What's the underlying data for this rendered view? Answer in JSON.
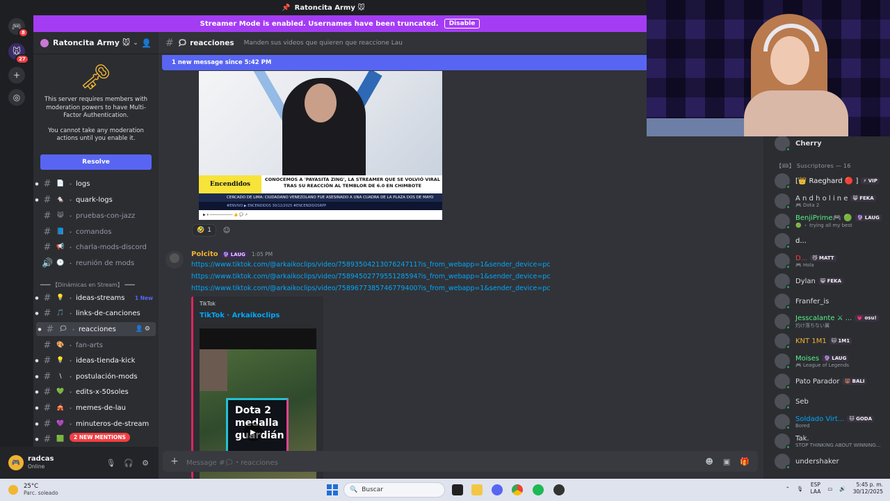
{
  "window": {
    "title": "Ratoncita Army 🐭"
  },
  "rail": {
    "dm_badge": "8",
    "server_badge": "27"
  },
  "streamer_banner": {
    "text": "Streamer Mode is enabled. Usernames have been truncated.",
    "button": "Disable"
  },
  "server": {
    "name": "Ratoncita Army 🐭",
    "mfa_text_1": "This server requires members with moderation powers to have Multi-Factor Authentication.",
    "mfa_text_2": "You cannot take any moderation actions until you enable it.",
    "resolve_label": "Resolve"
  },
  "channels": [
    {
      "name": "logs",
      "emoji": "📄",
      "unread": true
    },
    {
      "name": "quark-logs",
      "emoji": "🐁",
      "unread": true
    },
    {
      "name": "pruebas-con-jazz",
      "emoji": "😸",
      "unread": false
    },
    {
      "name": "comandos",
      "emoji": "📘",
      "unread": false
    },
    {
      "name": "charla-mods-discord",
      "emoji": "📢",
      "unread": false
    },
    {
      "name": "reunión de mods",
      "emoji": "🕒",
      "unread": false,
      "voice": true
    }
  ],
  "category": {
    "label": "━━━ 【Dinámicas en Stream】 ━━━"
  },
  "channels2": [
    {
      "name": "ideas-streams",
      "emoji": "💡",
      "unread": true,
      "badge": "1 New"
    },
    {
      "name": "links-de-canciones",
      "emoji": "🎵",
      "unread": true
    },
    {
      "name": "reacciones",
      "emoji": "🗯",
      "unread": true,
      "active": true
    },
    {
      "name": "fan-arts",
      "emoji": "🎨",
      "unread": false
    },
    {
      "name": "ideas-tienda-kick",
      "emoji": "💡",
      "unread": true
    },
    {
      "name": "postulación-mods",
      "emoji": "\\",
      "unread": true
    },
    {
      "name": "edits-x-50soles",
      "emoji": "💚",
      "unread": true
    },
    {
      "name": "memes-de-lau",
      "emoji": "🎪",
      "unread": true
    },
    {
      "name": "minuteros-de-stream",
      "emoji": "💜",
      "unread": true
    },
    {
      "name": "r",
      "emoji": "🟩",
      "unread": true
    }
  ],
  "mentions_pill": "2 NEW MENTIONS",
  "user": {
    "name": "radcas",
    "status": "Online"
  },
  "chat": {
    "channel": "reacciones",
    "topic": "Manden sus videos que quieren que reaccione Lau",
    "new_messages": "1 new message since 5:42 PM",
    "video": {
      "tag": "Encendidos",
      "headline": "CONOCEMOS A 'PAYASITA ZING', LA STREAMER QUE SE VOLVIÓ VIRAL TRAS SU REACCIÓN AL TEMBLOR DE 6.0 EN CHIMBOTE",
      "ticker": "CERCADO DE LIMA: CIUDADANO VENEZOLANO FUE ASESINADO A UNA CUADRA DE LA PLAZA DOS DE MAYO",
      "ticker2": "#ENVIVO ▶ ENCENDIDOS 30/12/2025 #ENCENDIDOSRPP"
    },
    "reaction": {
      "emoji": "🤣",
      "count": "1"
    },
    "message": {
      "author": "Polcito",
      "role_tag": "🔮 LAUG",
      "time": "1:05 PM",
      "links": [
        "https://www.tiktok.com/@arkaikoclips/video/7589350421307624711?is_from_webapp=1&sender_device=pc",
        "https://www.tiktok.com/@arkaikoclips/video/7589450277955128594?is_from_webapp=1&sender_device=pc",
        "https://www.tiktok.com/@arkaikoclips/video/7589677385746779400?is_from_webapp=1&sender_device=pc"
      ],
      "embed": {
        "provider": "TikTok",
        "title": "TikTok · Arkaikoclips",
        "thumb_text": "Dota 2 medalla guardián"
      }
    },
    "input_placeholder": "Message #🗯・reacciones"
  },
  "members": {
    "top": {
      "name": "Cherry",
      "color": "#f0b232"
    },
    "group_label": "【🎟】 Suscriptores — 16",
    "list": [
      {
        "name": "[👑 Raeghard 🔴 ]",
        "tag": "⚡ VIP",
        "color": "#f2f3f5",
        "sub": ""
      },
      {
        "name": "A n d h o l i n e",
        "tag": "😸 FEKA",
        "color": "#dbdee1",
        "sub": "🎮 Dota 2"
      },
      {
        "name": "BenjiPrime🎮 🟢",
        "tag": "🔮 LAUG",
        "color": "#57f287",
        "sub": "🟢 ・ trying all my best"
      },
      {
        "name": "d...",
        "tag": "",
        "color": "#f2f3f5",
        "sub": ""
      },
      {
        "name": "D...",
        "tag": "😼 MATT",
        "color": "#f23f43",
        "sub": "🎮 Hola"
      },
      {
        "name": "Dylan",
        "tag": "😸 FEKA",
        "color": "#dbdee1",
        "sub": ""
      },
      {
        "name": "Franfer_is",
        "tag": "",
        "color": "#dbdee1",
        "sub": ""
      },
      {
        "name": "Jesscalante ⚔ ...",
        "tag": "💗 osu!",
        "color": "#57f287",
        "sub": "灼け落ちない翼"
      },
      {
        "name": "KNT 1M1",
        "tag": "🐱 1M1",
        "color": "#f0b232",
        "sub": ""
      },
      {
        "name": "Moises",
        "tag": "🔮 LAUG",
        "color": "#57f287",
        "sub": "🎮 League of Legends"
      },
      {
        "name": "Pato Parador",
        "tag": "🐻 BALI",
        "color": "#dbdee1",
        "sub": ""
      },
      {
        "name": "Seb",
        "tag": "",
        "color": "#dbdee1",
        "sub": ""
      },
      {
        "name": "Soldado Virt...",
        "tag": "🐱 GODA",
        "color": "#00a8fc",
        "sub": "Bored"
      },
      {
        "name": "Tak.",
        "tag": "",
        "color": "#dbdee1",
        "sub": "STOP THINKING ABOUT WINNING..."
      },
      {
        "name": "undershaker",
        "tag": "",
        "color": "#dbdee1",
        "sub": ""
      }
    ]
  },
  "taskbar": {
    "weather_temp": "25°C",
    "weather_desc": "Parc. soleado",
    "search_placeholder": "Buscar",
    "lang_1": "ESP",
    "lang_2": "LAA",
    "time": "5:45 p. m.",
    "date": "30/12/2025"
  }
}
